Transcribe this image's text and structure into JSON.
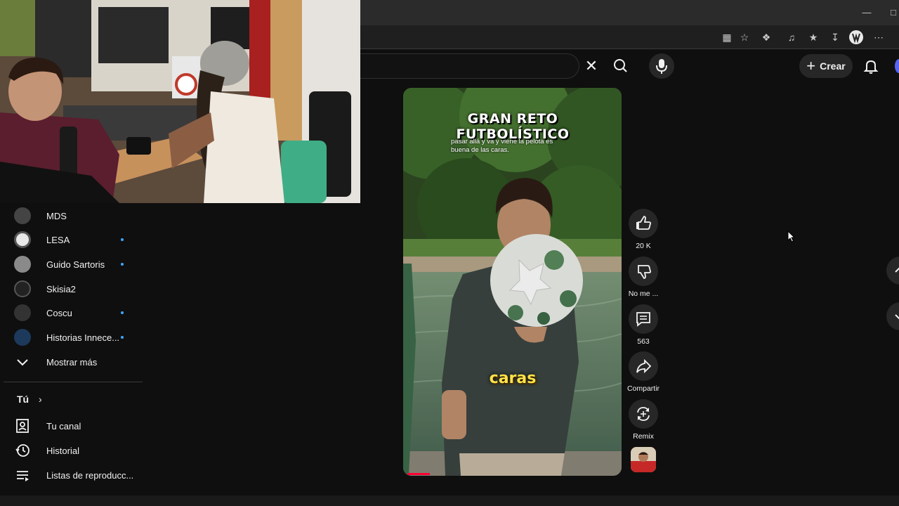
{
  "browser": {
    "window_controls": [
      "minimize",
      "restore"
    ],
    "toolbar_icons": [
      "tab-groups-icon",
      "favorite-star-icon",
      "extensions-icon",
      "media-icon",
      "favorites-icon",
      "downloads-icon",
      "profile-icon",
      "more-menu-icon"
    ]
  },
  "header": {
    "search_clear_icon": "close-icon",
    "search_icon": "search-icon",
    "mic_icon": "microphone-icon",
    "create_label": "Crear",
    "bell_icon": "bell-icon"
  },
  "sidebar": {
    "subscriptions": [
      {
        "label": "MDS",
        "new": false
      },
      {
        "label": "LESA",
        "new": true
      },
      {
        "label": "Guido Sartoris",
        "new": true
      },
      {
        "label": "Skisia2",
        "new": false
      },
      {
        "label": "Coscu",
        "new": true
      },
      {
        "label": "Historias Innece...",
        "new": true
      }
    ],
    "show_more": "Mostrar más",
    "you_section": {
      "title": "Tú",
      "items": [
        {
          "label": "Tu canal",
          "icon": "channel-icon"
        },
        {
          "label": "Historial",
          "icon": "history-icon"
        },
        {
          "label": "Listas de reproducc...",
          "icon": "playlists-icon"
        }
      ]
    }
  },
  "short": {
    "title": "GRAN RETO FUTBOLÍSTICO",
    "caption": "pasar allá y va y viene la pelota es buena de las caras.",
    "subtitle_word": "caras"
  },
  "actions": {
    "like_count": "20 K",
    "dislike_label": "No me ...",
    "comments_count": "563",
    "share_label": "Compartir",
    "remix_label": "Remix"
  },
  "colors": {
    "background": "#0f0f0f",
    "button_bg": "#272727",
    "accent_red": "#ff0033",
    "new_dot": "#3ea6ff",
    "subtitle_yellow": "#ffe34a"
  }
}
